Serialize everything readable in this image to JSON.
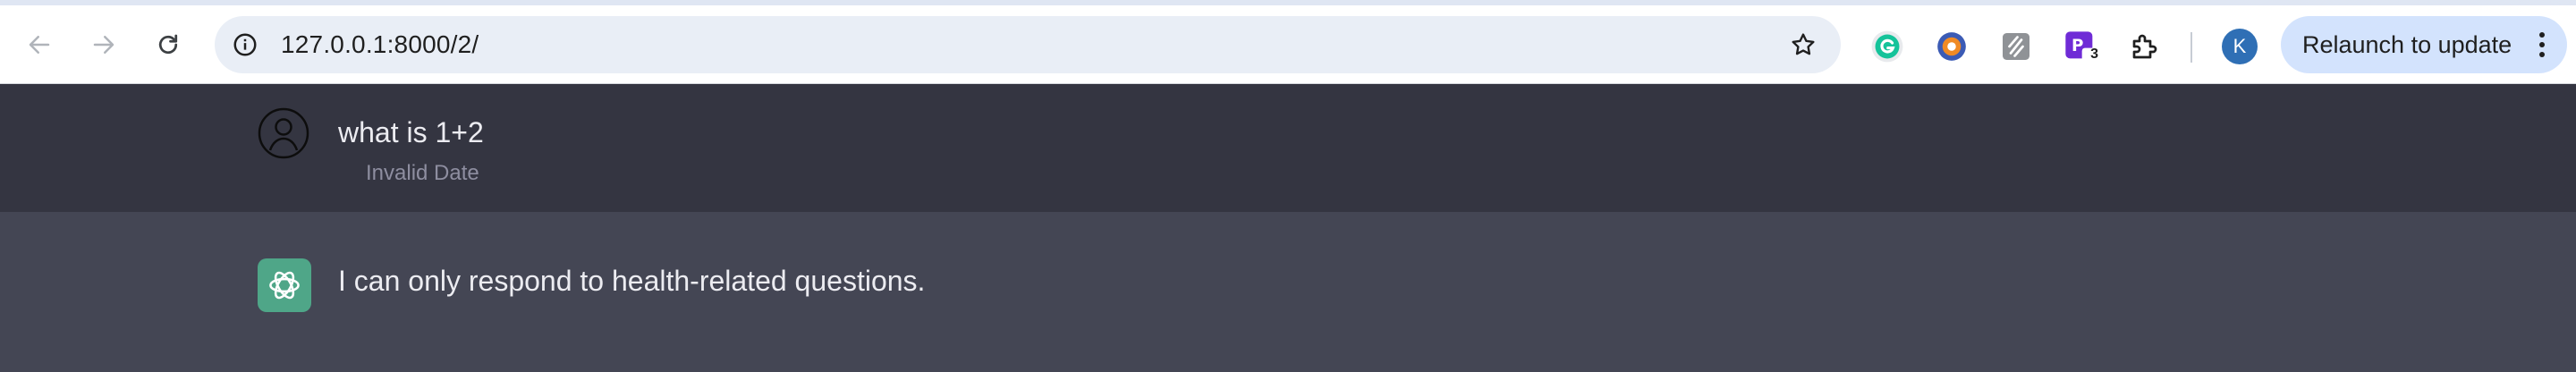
{
  "browser": {
    "url": "127.0.0.1:8000/2/",
    "relaunch_label": "Relaunch to update",
    "profile_initial": "K",
    "extension_badge": "3"
  },
  "chat": {
    "user_message": "what is 1+2",
    "user_timestamp": "Invalid Date",
    "bot_message": "I can only respond to health-related questions."
  },
  "colors": {
    "user_row_bg": "#343541",
    "bot_row_bg": "#444654",
    "bot_avatar": "#4fa688",
    "relaunch_bg": "#d3e3fd"
  }
}
